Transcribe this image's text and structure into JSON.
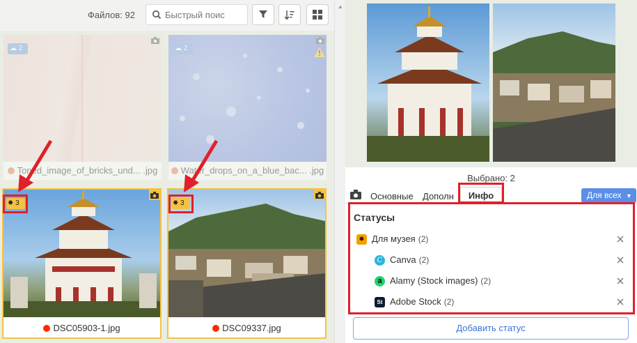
{
  "toolbar": {
    "files_count": "Файлов: 92",
    "search_placeholder": "Быстрый поис"
  },
  "grid": {
    "items": [
      {
        "filename": "Toned_image_of_bricks_und... .jpg",
        "dot_color": "#f08060",
        "cloud_count": "2"
      },
      {
        "filename": "Water_drops_on_a_blue_bac... .jpg",
        "dot_color": "#f08060",
        "cloud_count": "2"
      },
      {
        "filename": "DSC05903-1.jpg",
        "dot_color": "#ff2a00",
        "status_count": "3"
      },
      {
        "filename": "DSC09337.jpg",
        "dot_color": "#ff2a00",
        "status_count": "3"
      }
    ]
  },
  "panel": {
    "selected": "Выбрано: 2",
    "tabs": [
      "Основные",
      "Дополн",
      "Инфо"
    ],
    "for_all": "Для всех",
    "statuses_title": "Статусы",
    "statuses": [
      {
        "label": "Для музея",
        "count": "(2)",
        "icon": "sun-icon",
        "color": "#f5a000"
      },
      {
        "label": "Canva",
        "count": "(2)",
        "icon": "canva-icon",
        "color": "#2ab4d8"
      },
      {
        "label": "Alamy (Stock images)",
        "count": "(2)",
        "icon": "alamy-icon",
        "color": "#20d36a"
      },
      {
        "label": "Adobe Stock",
        "count": "(2)",
        "icon": "adobe-stock-icon",
        "color": "#0b1a33"
      }
    ],
    "add_status": "Добавить статус"
  },
  "colors": {
    "accent": "#5b8ee6",
    "selection": "#f5c242",
    "highlight": "#e0202a"
  }
}
